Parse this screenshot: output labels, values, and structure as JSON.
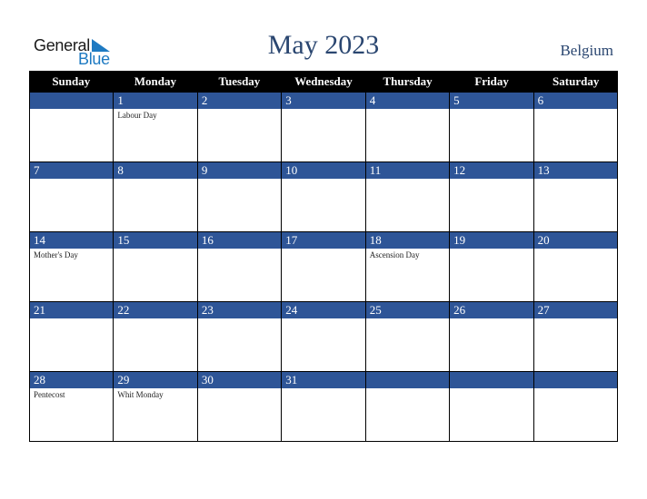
{
  "logo": {
    "line1": "General",
    "line2": "Blue",
    "icon": "triangle-flag-icon",
    "accent_color": "#1e7ac2"
  },
  "title": "May 2023",
  "country": "Belgium",
  "colors": {
    "header_bg": "#000000",
    "band_bg": "#2e5597",
    "title_color": "#2a4670"
  },
  "weekdays": [
    "Sunday",
    "Monday",
    "Tuesday",
    "Wednesday",
    "Thursday",
    "Friday",
    "Saturday"
  ],
  "weeks": [
    [
      {
        "day": "",
        "holiday": ""
      },
      {
        "day": "1",
        "holiday": "Labour Day"
      },
      {
        "day": "2",
        "holiday": ""
      },
      {
        "day": "3",
        "holiday": ""
      },
      {
        "day": "4",
        "holiday": ""
      },
      {
        "day": "5",
        "holiday": ""
      },
      {
        "day": "6",
        "holiday": ""
      }
    ],
    [
      {
        "day": "7",
        "holiday": ""
      },
      {
        "day": "8",
        "holiday": ""
      },
      {
        "day": "9",
        "holiday": ""
      },
      {
        "day": "10",
        "holiday": ""
      },
      {
        "day": "11",
        "holiday": ""
      },
      {
        "day": "12",
        "holiday": ""
      },
      {
        "day": "13",
        "holiday": ""
      }
    ],
    [
      {
        "day": "14",
        "holiday": "Mother's Day"
      },
      {
        "day": "15",
        "holiday": ""
      },
      {
        "day": "16",
        "holiday": ""
      },
      {
        "day": "17",
        "holiday": ""
      },
      {
        "day": "18",
        "holiday": "Ascension Day"
      },
      {
        "day": "19",
        "holiday": ""
      },
      {
        "day": "20",
        "holiday": ""
      }
    ],
    [
      {
        "day": "21",
        "holiday": ""
      },
      {
        "day": "22",
        "holiday": ""
      },
      {
        "day": "23",
        "holiday": ""
      },
      {
        "day": "24",
        "holiday": ""
      },
      {
        "day": "25",
        "holiday": ""
      },
      {
        "day": "26",
        "holiday": ""
      },
      {
        "day": "27",
        "holiday": ""
      }
    ],
    [
      {
        "day": "28",
        "holiday": "Pentecost"
      },
      {
        "day": "29",
        "holiday": "Whit Monday"
      },
      {
        "day": "30",
        "holiday": ""
      },
      {
        "day": "31",
        "holiday": ""
      },
      {
        "day": "",
        "holiday": ""
      },
      {
        "day": "",
        "holiday": ""
      },
      {
        "day": "",
        "holiday": ""
      }
    ]
  ]
}
